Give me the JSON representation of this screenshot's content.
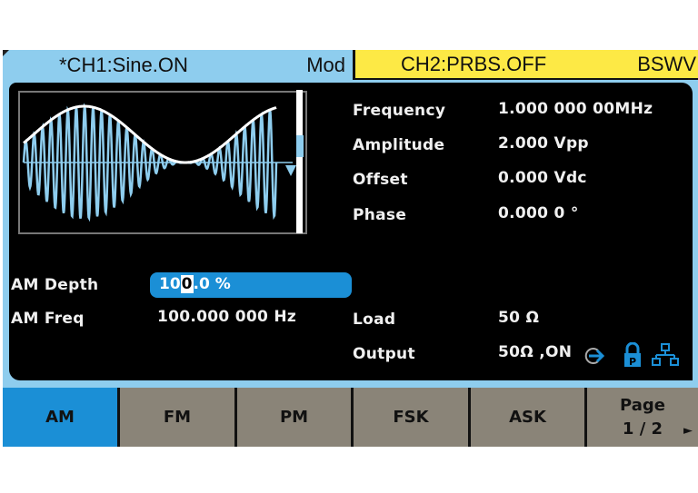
{
  "header": {
    "ch1_title": "*CH1:Sine.ON",
    "ch1_mode": "Mod",
    "ch2_title": "CH2:PRBS.OFF",
    "ch2_mode": "BSWV"
  },
  "colors": {
    "ch1_tab": "#8ecdee",
    "ch2_tab": "#fde945",
    "accent_blue": "#1b8fd6",
    "softkey_gray": "#8a8478",
    "wave_carrier": "#8ecdee",
    "wave_envelope": "#ffffff"
  },
  "waveform": {
    "type": "AM modulated sine preview",
    "icon": "am-waveform-preview"
  },
  "params": [
    {
      "label": "Frequency",
      "value": "1.000 000 00MHz"
    },
    {
      "label": "Amplitude",
      "value": "2.000 Vpp"
    },
    {
      "label": "Offset",
      "value": "0.000 Vdc"
    },
    {
      "label": "Phase",
      "value": "0.000 0 °"
    }
  ],
  "mod_params": {
    "depth_label": "AM Depth",
    "depth_value_pre": "10",
    "depth_value_cursor": "0",
    "depth_value_post": ".0 %",
    "freq_label": "AM Freq",
    "freq_value": "100.000 000 Hz"
  },
  "output": {
    "load_label": "Load",
    "load_value": "50 Ω",
    "output_label": "Output",
    "output_value": "50Ω ,ON",
    "icons": [
      "output-arrow-icon",
      "lock-icon",
      "network-icon"
    ]
  },
  "softkeys": [
    {
      "label": "AM",
      "active": true
    },
    {
      "label": "FM",
      "active": false
    },
    {
      "label": "PM",
      "active": false
    },
    {
      "label": "FSK",
      "active": false
    },
    {
      "label": "ASK",
      "active": false
    },
    {
      "label": "Page",
      "sub": "1 / 2",
      "arrow": "►"
    }
  ]
}
